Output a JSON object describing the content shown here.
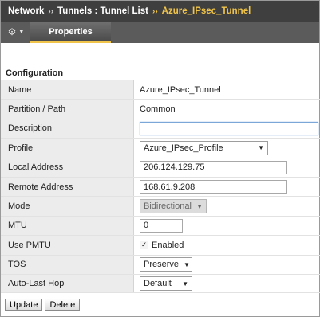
{
  "breadcrumb": {
    "section": "Network",
    "separator": "››",
    "parent": "Tunnels : Tunnel List",
    "current": "Azure_IPsec_Tunnel"
  },
  "tabs": {
    "gear_icon": "⚙",
    "chevron": "▼",
    "properties": "Properties"
  },
  "section_title": "Configuration",
  "fields": {
    "name": {
      "label": "Name",
      "value": "Azure_IPsec_Tunnel"
    },
    "partition": {
      "label": "Partition / Path",
      "value": "Common"
    },
    "description": {
      "label": "Description",
      "value": ""
    },
    "profile": {
      "label": "Profile",
      "value": "Azure_IPsec_Profile",
      "arrow": "▼"
    },
    "local_address": {
      "label": "Local Address",
      "value": "206.124.129.75"
    },
    "remote_address": {
      "label": "Remote Address",
      "value": "168.61.9.208"
    },
    "mode": {
      "label": "Mode",
      "value": "Bidirectional",
      "arrow": "▼"
    },
    "mtu": {
      "label": "MTU",
      "value": "0"
    },
    "use_pmtu": {
      "label": "Use PMTU",
      "checked": true,
      "check_glyph": "✓",
      "value": "Enabled"
    },
    "tos": {
      "label": "TOS",
      "value": "Preserve",
      "arrow": "▼"
    },
    "auto_last_hop": {
      "label": "Auto-Last Hop",
      "value": "Default",
      "arrow": "▼"
    }
  },
  "buttons": {
    "update": "Update",
    "delete": "Delete"
  },
  "colors": {
    "header_bg": "#3f3f3f",
    "accent": "#f0c44a",
    "label_bg": "#ececec"
  }
}
